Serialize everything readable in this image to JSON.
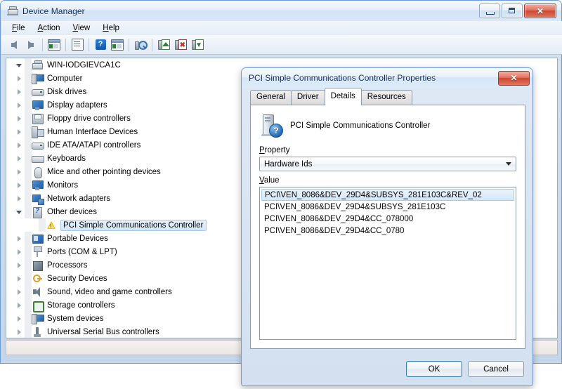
{
  "main_window": {
    "title": "Device Manager",
    "title_icon": "device-manager-icon",
    "window_buttons": {
      "minimize": "—",
      "maximize": "□",
      "close": "✕"
    },
    "menus": [
      {
        "label": "File",
        "accel": "F"
      },
      {
        "label": "Action",
        "accel": "A"
      },
      {
        "label": "View",
        "accel": "V"
      },
      {
        "label": "Help",
        "accel": "H"
      }
    ],
    "toolbar": [
      {
        "name": "back-button",
        "icon": "back-arrow-icon"
      },
      {
        "name": "forward-button",
        "icon": "forward-arrow-icon"
      },
      {
        "name": "show-hide-console-tree",
        "icon": "console-tree-icon"
      },
      {
        "name": "properties-button",
        "icon": "properties-icon"
      },
      {
        "name": "help-button",
        "icon": "help-icon"
      },
      {
        "name": "show-hide-action-pane",
        "icon": "action-pane-icon"
      },
      {
        "name": "scan-hardware-changes",
        "icon": "scan-hardware-icon"
      },
      {
        "name": "update-driver-button",
        "icon": "update-driver-icon"
      },
      {
        "name": "uninstall-device-button",
        "icon": "uninstall-device-icon"
      },
      {
        "name": "disable-device-button",
        "icon": "disable-device-icon"
      }
    ],
    "status_text": ""
  },
  "tree": {
    "root": {
      "label": "WIN-IODGIEVCA1C",
      "icon": "computer-root-icon",
      "expanded": true
    },
    "items": [
      {
        "label": "Computer",
        "icon": "ic-pc",
        "icon_name": "computer-icon",
        "expanded": false,
        "level": 1,
        "selected": false
      },
      {
        "label": "Disk drives",
        "icon": "ic-disk",
        "icon_name": "disk-drive-icon",
        "expanded": false,
        "level": 1,
        "selected": false
      },
      {
        "label": "Display adapters",
        "icon": "ic-monitor",
        "icon_name": "display-adapter-icon",
        "expanded": false,
        "level": 1,
        "selected": false
      },
      {
        "label": "Floppy drive controllers",
        "icon": "ic-floppy",
        "icon_name": "floppy-controller-icon",
        "expanded": false,
        "level": 1,
        "selected": false
      },
      {
        "label": "Human Interface Devices",
        "icon": "ic-hid",
        "icon_name": "human-interface-icon",
        "expanded": false,
        "level": 1,
        "selected": false
      },
      {
        "label": "IDE ATA/ATAPI controllers",
        "icon": "ic-disk",
        "icon_name": "ide-controller-icon",
        "expanded": false,
        "level": 1,
        "selected": false
      },
      {
        "label": "Keyboards",
        "icon": "ic-kbd",
        "icon_name": "keyboard-icon",
        "expanded": false,
        "level": 1,
        "selected": false
      },
      {
        "label": "Mice and other pointing devices",
        "icon": "ic-mouse",
        "icon_name": "mouse-icon",
        "expanded": false,
        "level": 1,
        "selected": false
      },
      {
        "label": "Monitors",
        "icon": "ic-monitor",
        "icon_name": "monitor-icon",
        "expanded": false,
        "level": 1,
        "selected": false
      },
      {
        "label": "Network adapters",
        "icon": "ic-net",
        "icon_name": "network-adapter-icon",
        "expanded": false,
        "level": 1,
        "selected": false
      },
      {
        "label": "Other devices",
        "icon": "ic-other",
        "icon_name": "other-devices-icon",
        "expanded": true,
        "level": 1,
        "selected": false
      },
      {
        "label": "PCI Simple Communications Controller",
        "icon": "ic-warn",
        "icon_name": "warning-device-icon",
        "expanded": null,
        "level": 2,
        "selected": true
      },
      {
        "label": "Portable Devices",
        "icon": "ic-pd",
        "icon_name": "portable-device-icon",
        "expanded": false,
        "level": 1,
        "selected": false
      },
      {
        "label": "Ports (COM & LPT)",
        "icon": "ic-port",
        "icon_name": "ports-icon",
        "expanded": false,
        "level": 1,
        "selected": false
      },
      {
        "label": "Processors",
        "icon": "ic-cpu",
        "icon_name": "processor-icon",
        "expanded": false,
        "level": 1,
        "selected": false
      },
      {
        "label": "Security Devices",
        "icon": "ic-sec",
        "icon_name": "security-device-icon",
        "expanded": false,
        "level": 1,
        "selected": false
      },
      {
        "label": "Sound, video and game controllers",
        "icon": "ic-snd",
        "icon_name": "sound-controller-icon",
        "expanded": false,
        "level": 1,
        "selected": false
      },
      {
        "label": "Storage controllers",
        "icon": "ic-stor",
        "icon_name": "storage-controller-icon",
        "expanded": false,
        "level": 1,
        "selected": false
      },
      {
        "label": "System devices",
        "icon": "ic-pc",
        "icon_name": "system-device-icon",
        "expanded": false,
        "level": 1,
        "selected": false
      },
      {
        "label": "Universal Serial Bus controllers",
        "icon": "ic-usb",
        "icon_name": "usb-controller-icon",
        "expanded": false,
        "level": 1,
        "selected": false
      }
    ]
  },
  "dialog": {
    "title": "PCI Simple Communications Controller Properties",
    "close_glyph": "✕",
    "tabs": [
      {
        "label": "General",
        "active": false
      },
      {
        "label": "Driver",
        "active": false
      },
      {
        "label": "Details",
        "active": true
      },
      {
        "label": "Resources",
        "active": false
      }
    ],
    "device_name": "PCI Simple Communications Controller",
    "device_icon": "unknown-device-icon",
    "device_badge": "?",
    "property": {
      "label": "Property",
      "accel": "P",
      "selected": "Hardware Ids"
    },
    "value": {
      "label": "Value",
      "accel": "V",
      "rows": [
        {
          "text": "PCI\\VEN_8086&DEV_29D4&SUBSYS_281E103C&REV_02",
          "selected": true
        },
        {
          "text": "PCI\\VEN_8086&DEV_29D4&SUBSYS_281E103C",
          "selected": false
        },
        {
          "text": "PCI\\VEN_8086&DEV_29D4&CC_078000",
          "selected": false
        },
        {
          "text": "PCI\\VEN_8086&DEV_29D4&CC_0780",
          "selected": false
        }
      ]
    },
    "buttons": {
      "ok": "OK",
      "cancel": "Cancel"
    }
  },
  "colors": {
    "title_text": "#0b2d5c",
    "selection_fill": "#d2e7f8",
    "selection_border": "#a8cbe9",
    "close_button": "#cf4730",
    "warning_yellow": "#f0c000",
    "default_button_border": "#3c7fb1"
  }
}
